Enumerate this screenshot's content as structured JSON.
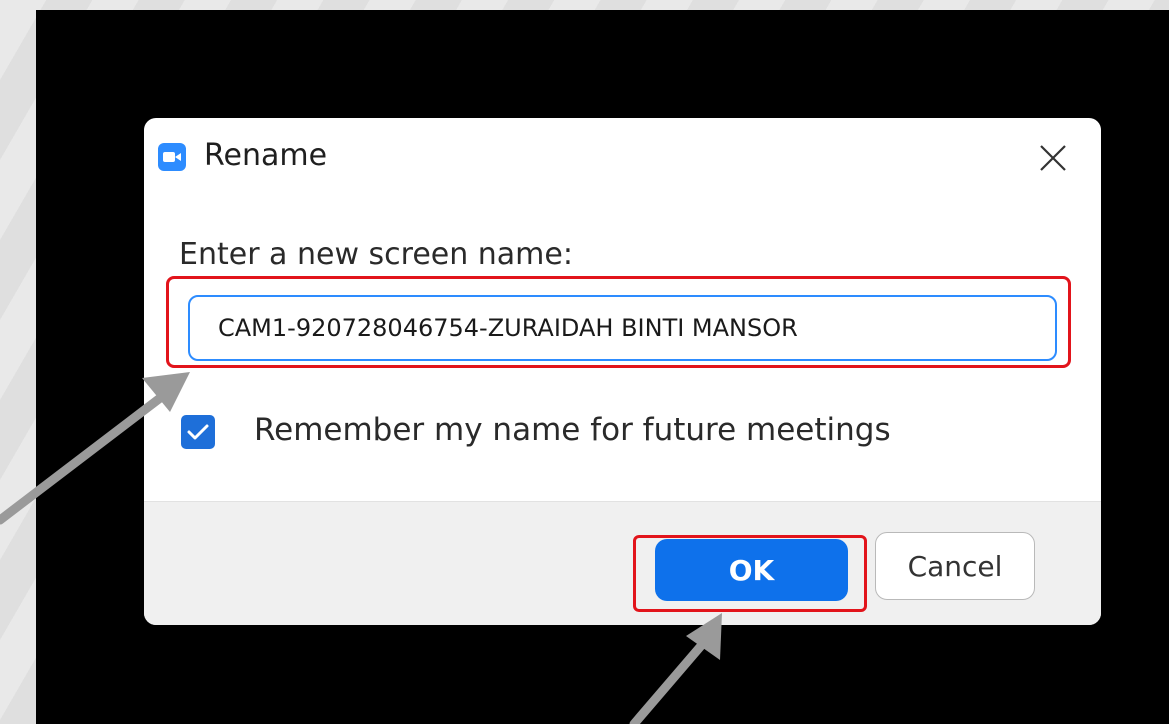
{
  "dialog": {
    "title": "Rename",
    "prompt_label": "Enter a new screen name:",
    "name_input_value": "CAM1-920728046754-ZURAIDAH BINTI MANSOR",
    "remember_checked": true,
    "remember_label": "Remember my name for future meetings",
    "ok_label": "OK",
    "cancel_label": "Cancel"
  },
  "icons": {
    "app": "zoom-camera-icon",
    "close": "close-icon",
    "checkbox": "checkmark-icon"
  },
  "colors": {
    "accent": "#2d8cff",
    "ok_button": "#0e71eb",
    "checkbox": "#1e6fd9",
    "highlight": "#e2141b",
    "arrow": "#9a9a9a"
  }
}
